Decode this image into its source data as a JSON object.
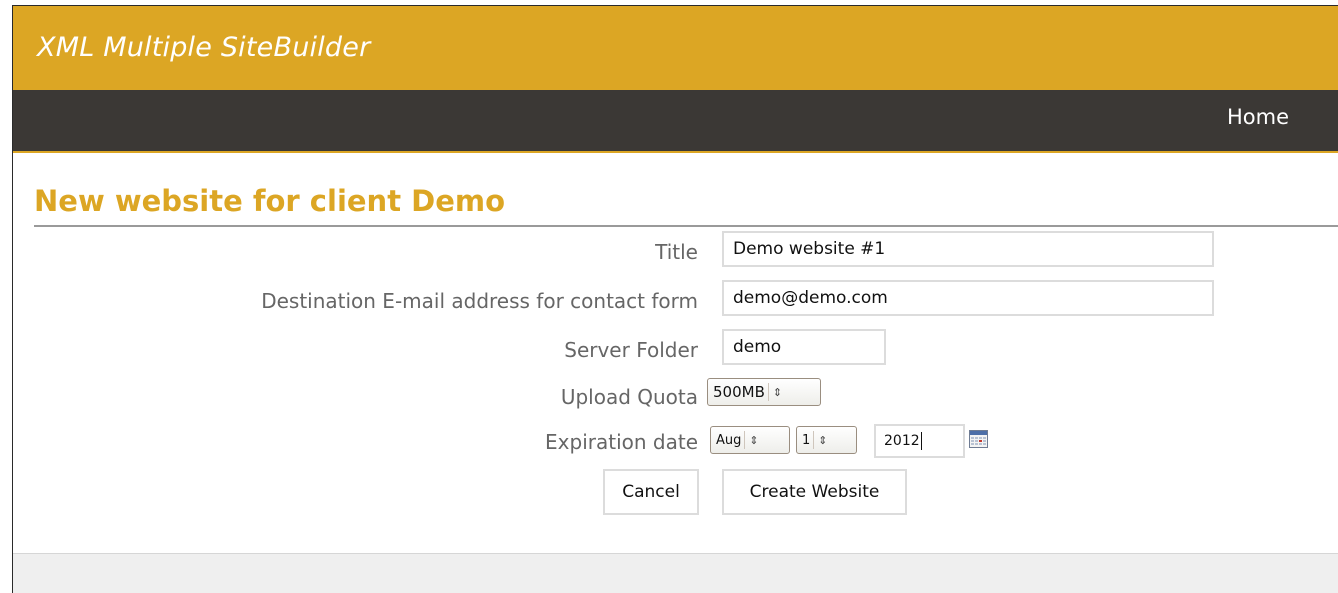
{
  "app": {
    "title": "XML Multiple SiteBuilder"
  },
  "nav": {
    "home_label": "Home"
  },
  "page": {
    "heading": "New website for client Demo"
  },
  "form": {
    "title": {
      "label": "Title",
      "value": "Demo website #1"
    },
    "email": {
      "label": "Destination E-mail address for contact form",
      "value": "demo@demo.com"
    },
    "folder": {
      "label": "Server Folder",
      "value": "demo"
    },
    "quota": {
      "label": "Upload Quota",
      "selected": "500MB"
    },
    "expiration": {
      "label": "Expiration date",
      "month": "Aug",
      "day": "1",
      "year": "2012"
    },
    "cancel_label": "Cancel",
    "submit_label": "Create Website"
  },
  "colors": {
    "brand": "#dca624",
    "navbar": "#3b3835",
    "label": "#666666"
  },
  "icons": {
    "calendar": "calendar-icon",
    "select_arrows": "updown-chevron-icon"
  }
}
